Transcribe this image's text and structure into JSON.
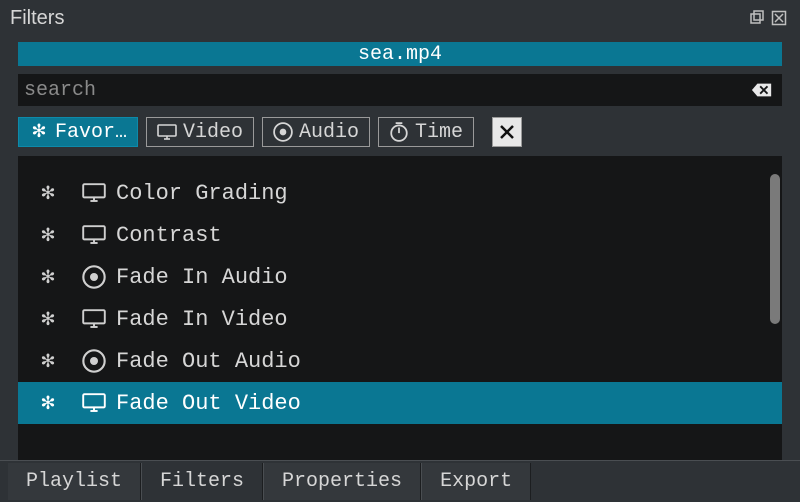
{
  "panel": {
    "title": "Filters"
  },
  "file": {
    "name": "sea.mp4"
  },
  "search": {
    "placeholder": "search",
    "value": ""
  },
  "categories": {
    "favorites": "Favor…",
    "video": "Video",
    "audio": "Audio",
    "time": "Time"
  },
  "filters": {
    "partial_top": "",
    "items": [
      {
        "name": "Color Grading",
        "type": "video",
        "selected": false
      },
      {
        "name": "Contrast",
        "type": "video",
        "selected": false
      },
      {
        "name": "Fade In Audio",
        "type": "audio",
        "selected": false
      },
      {
        "name": "Fade In Video",
        "type": "video",
        "selected": false
      },
      {
        "name": "Fade Out Audio",
        "type": "audio",
        "selected": false
      },
      {
        "name": "Fade Out Video",
        "type": "video",
        "selected": true
      }
    ]
  },
  "bottom_tabs": {
    "playlist": "Playlist",
    "filters": "Filters",
    "properties": "Properties",
    "export": "Export",
    "active": "filters"
  }
}
